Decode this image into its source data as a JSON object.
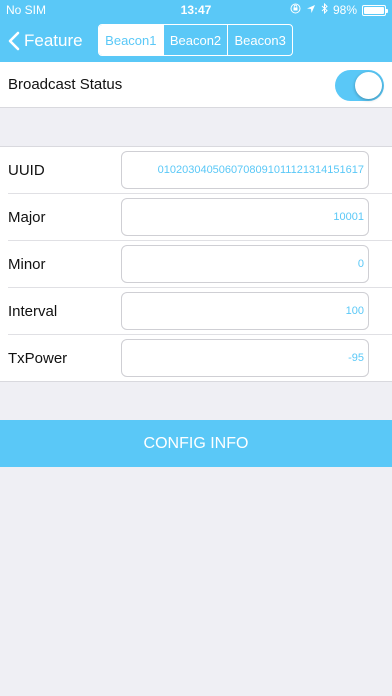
{
  "status_bar": {
    "carrier": "No SIM",
    "time": "13:47",
    "battery_percent": "98%",
    "battery_level": 0.98,
    "icons": [
      "orientation-lock-icon",
      "location-arrow-icon",
      "bluetooth-icon",
      "battery-icon"
    ]
  },
  "nav": {
    "back_label": "Feature",
    "back_icon": "chevron-left-icon",
    "segments": [
      "Beacon1",
      "Beacon2",
      "Beacon3"
    ],
    "selected_segment": "Beacon1"
  },
  "broadcast": {
    "label": "Broadcast Status",
    "enabled": true
  },
  "fields": [
    {
      "label": "UUID",
      "value": "0102030405060708091011121314151617"
    },
    {
      "label": "Major",
      "value": "10001"
    },
    {
      "label": "Minor",
      "value": "0"
    },
    {
      "label": "Interval",
      "value": "100"
    },
    {
      "label": "TxPower",
      "value": "-95"
    }
  ],
  "config_button": "CONFIG INFO",
  "colors": {
    "accent": "#5ac8f7",
    "background": "#efeff4",
    "text": "#111111"
  }
}
